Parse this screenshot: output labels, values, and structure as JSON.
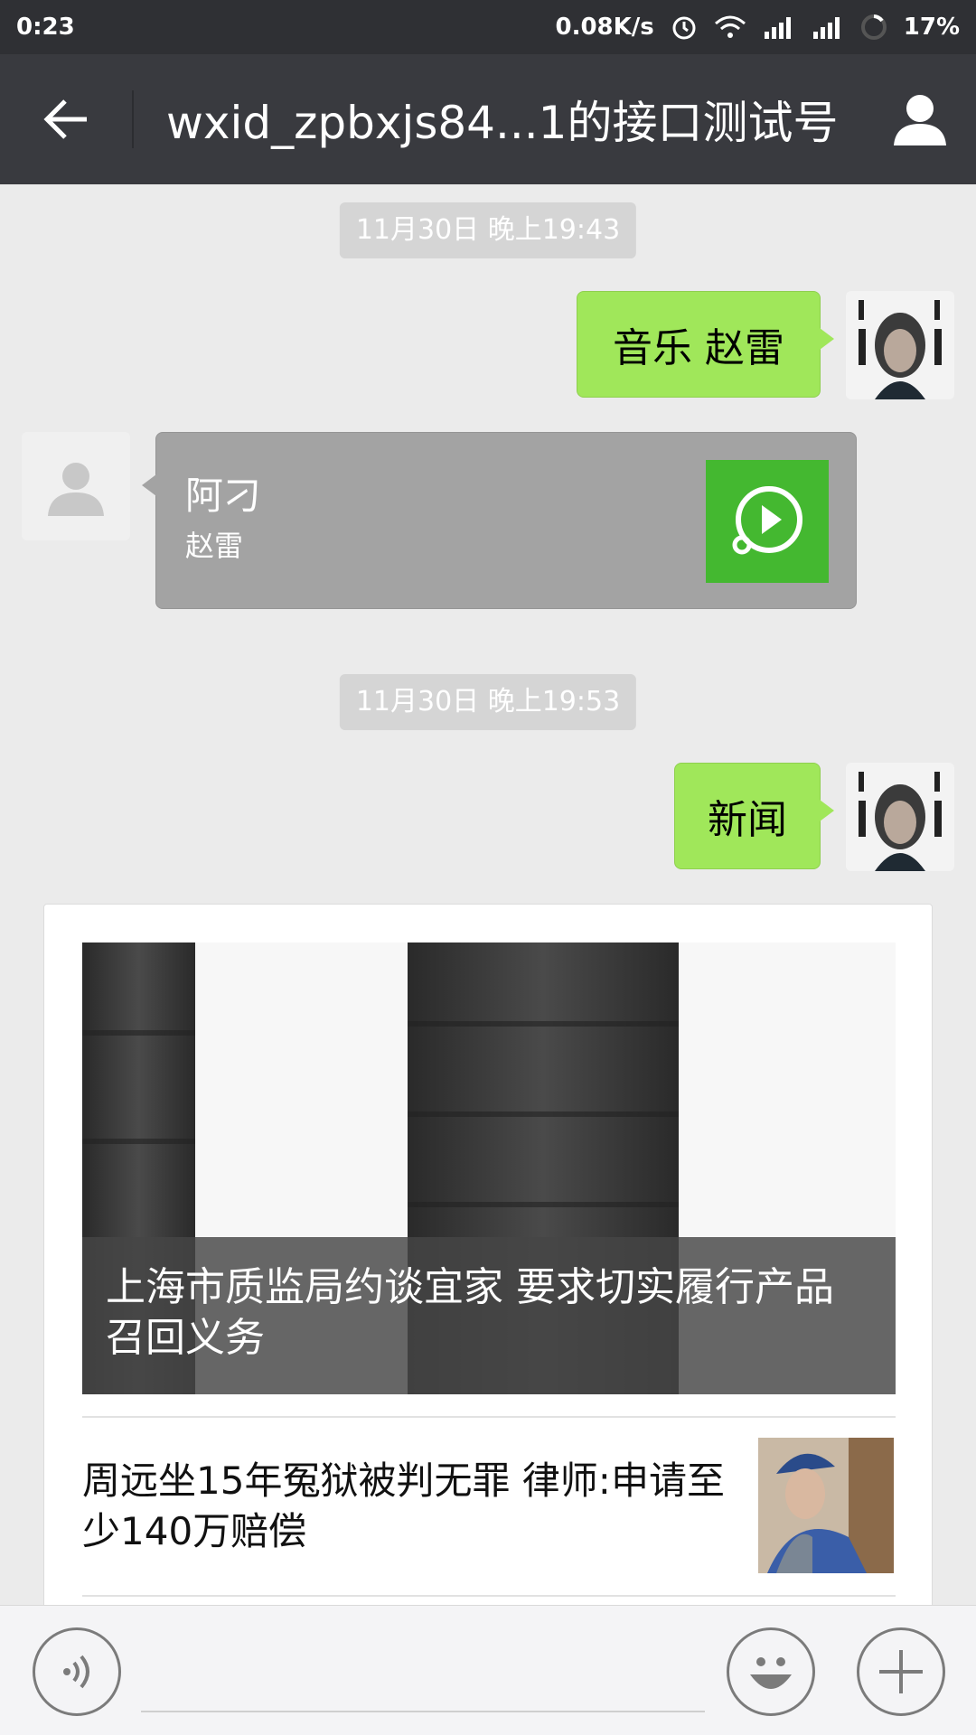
{
  "status_bar": {
    "time": "0:23",
    "net_speed": "0.08K/s",
    "battery": "17%"
  },
  "header": {
    "title": "wxid_zpbxjs84...1的接口测试号"
  },
  "messages": {
    "timestamp_1": "11月30日 晚上19:43",
    "sent_1": "音乐 赵雷",
    "music": {
      "title": "阿刁",
      "artist": "赵雷"
    },
    "timestamp_2": "11月30日 晚上19:53",
    "sent_2": "新闻",
    "news": {
      "headline": "上海市质监局约谈宜家 要求切实履行产品召回义务",
      "item_1": "周远坐15年冤狱被判无罪 律师:申请至少140万赔偿"
    }
  },
  "colors": {
    "header_bg": "#393a3f",
    "sent_bubble": "#a0e75a",
    "music_cover": "#44b830"
  },
  "icons": [
    "back-arrow-icon",
    "profile-icon",
    "music-play-icon",
    "voice-icon",
    "emoji-icon",
    "plus-icon"
  ]
}
